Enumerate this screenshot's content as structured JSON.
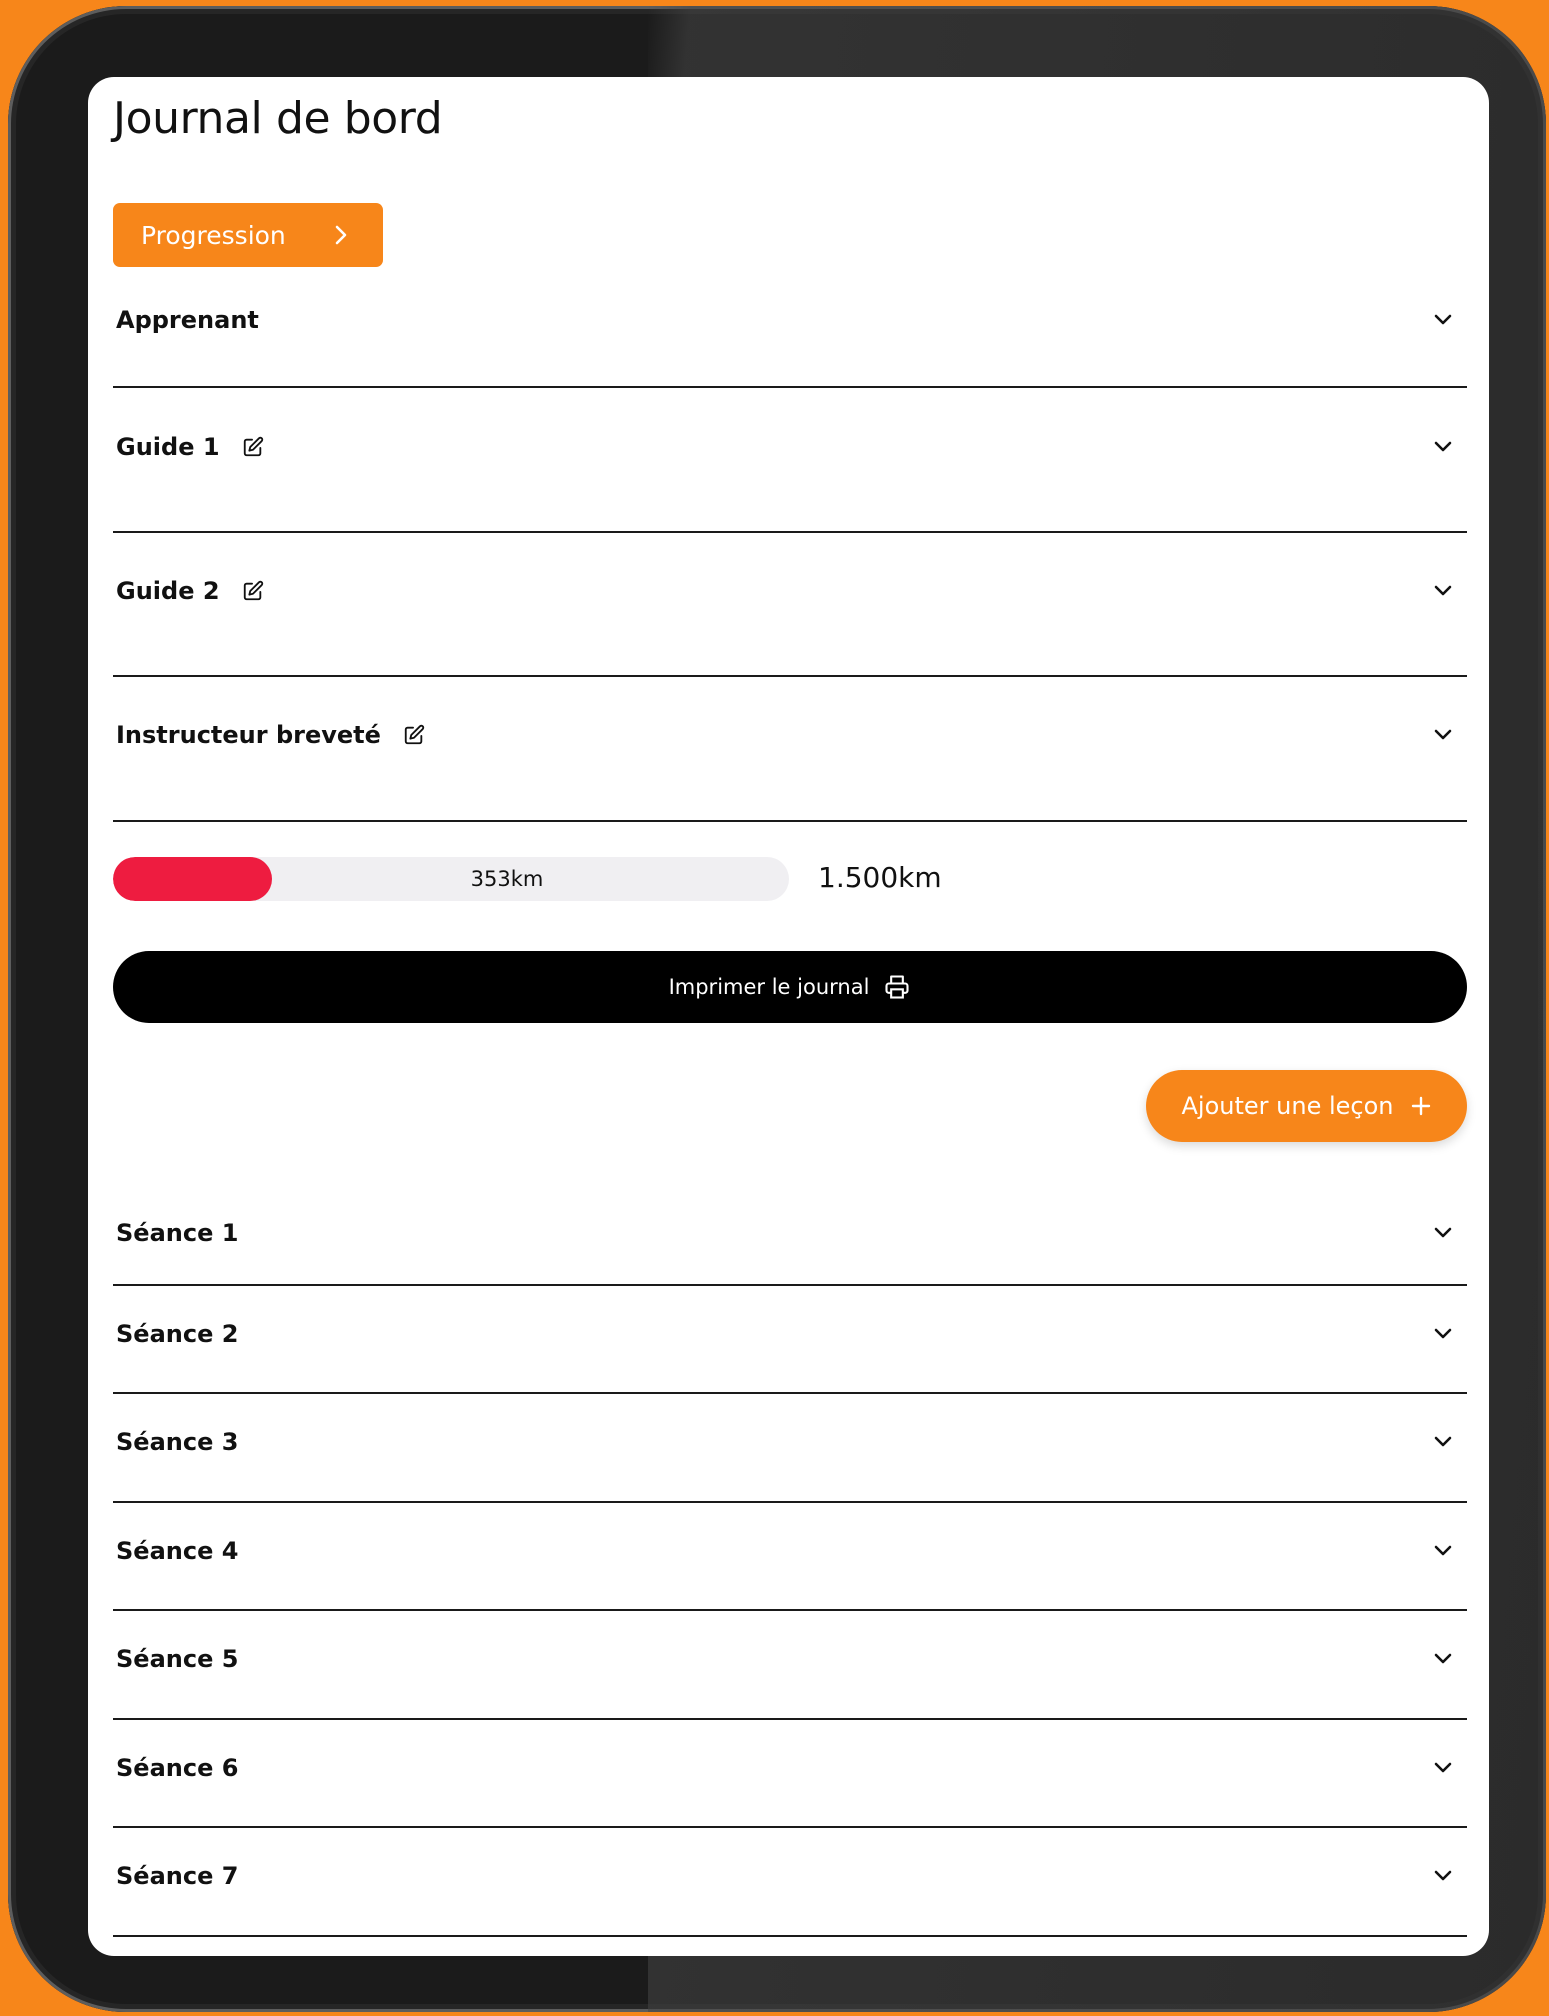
{
  "page": {
    "title": "Journal de bord"
  },
  "progression_button": {
    "label": "Progression",
    "icon": "chevron-right-icon"
  },
  "profile_sections": [
    {
      "label": "Apprenant",
      "editable": false
    },
    {
      "label": "Guide 1",
      "editable": true
    },
    {
      "label": "Guide 2",
      "editable": true
    },
    {
      "label": "Instructeur breveté",
      "editable": true
    }
  ],
  "distance": {
    "current_label": "353km",
    "target_label": "1.500km",
    "current_km": 353,
    "target_km": 1500,
    "fill_color": "#ee1c40"
  },
  "print_button": {
    "label": "Imprimer le journal",
    "icon": "printer-icon"
  },
  "add_lesson_button": {
    "label": "Ajouter une leçon",
    "icon": "plus-icon"
  },
  "sessions": [
    {
      "label": "Séance 1"
    },
    {
      "label": "Séance 2"
    },
    {
      "label": "Séance 3"
    },
    {
      "label": "Séance 4"
    },
    {
      "label": "Séance 5"
    },
    {
      "label": "Séance 6"
    },
    {
      "label": "Séance 7"
    }
  ],
  "colors": {
    "accent": "#f7861a",
    "progress_fill": "#ee1c40",
    "progress_track": "#f0eff2",
    "primary_button": "#000000"
  }
}
